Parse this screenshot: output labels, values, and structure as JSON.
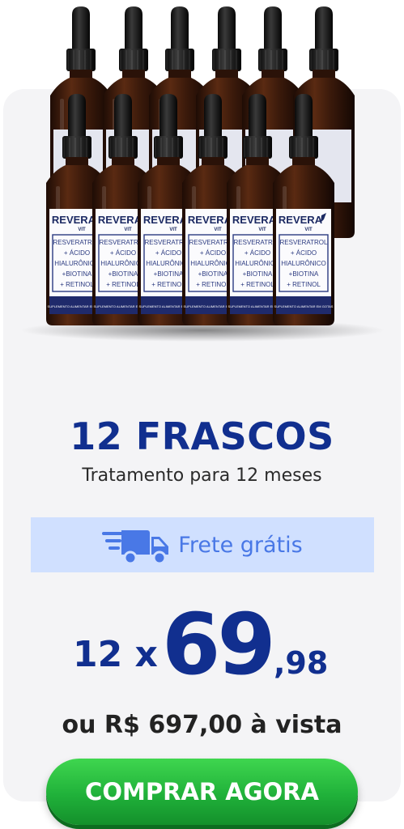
{
  "offer": {
    "title": "12 FRASCOS",
    "subtitle": "Tratamento para 12 meses",
    "shipping_label": "Frete grátis",
    "installments_prefix": "12 x",
    "price_integer": "69",
    "price_cents": ",98",
    "cash_price": "ou R$ 697,00 à vista",
    "cta_label": "COMPRAR AGORA"
  },
  "product_label": {
    "brand": "REVERA",
    "brand_sub": "VIT",
    "ingredients": [
      "RESVERATROL",
      "+ ÁCIDO",
      "HIALURÔNICO",
      "+BIOTINA",
      "+ RETINOL"
    ],
    "footer": "SUPLEMENTO ALIMENTAR EM GOTAS"
  },
  "colors": {
    "brand_navy": "#112f8f",
    "shipping_bg": "#d0e0ff",
    "shipping_text": "#4978e6",
    "cta_green": "#20b13a"
  },
  "icons": [
    "delivery-truck-icon"
  ]
}
